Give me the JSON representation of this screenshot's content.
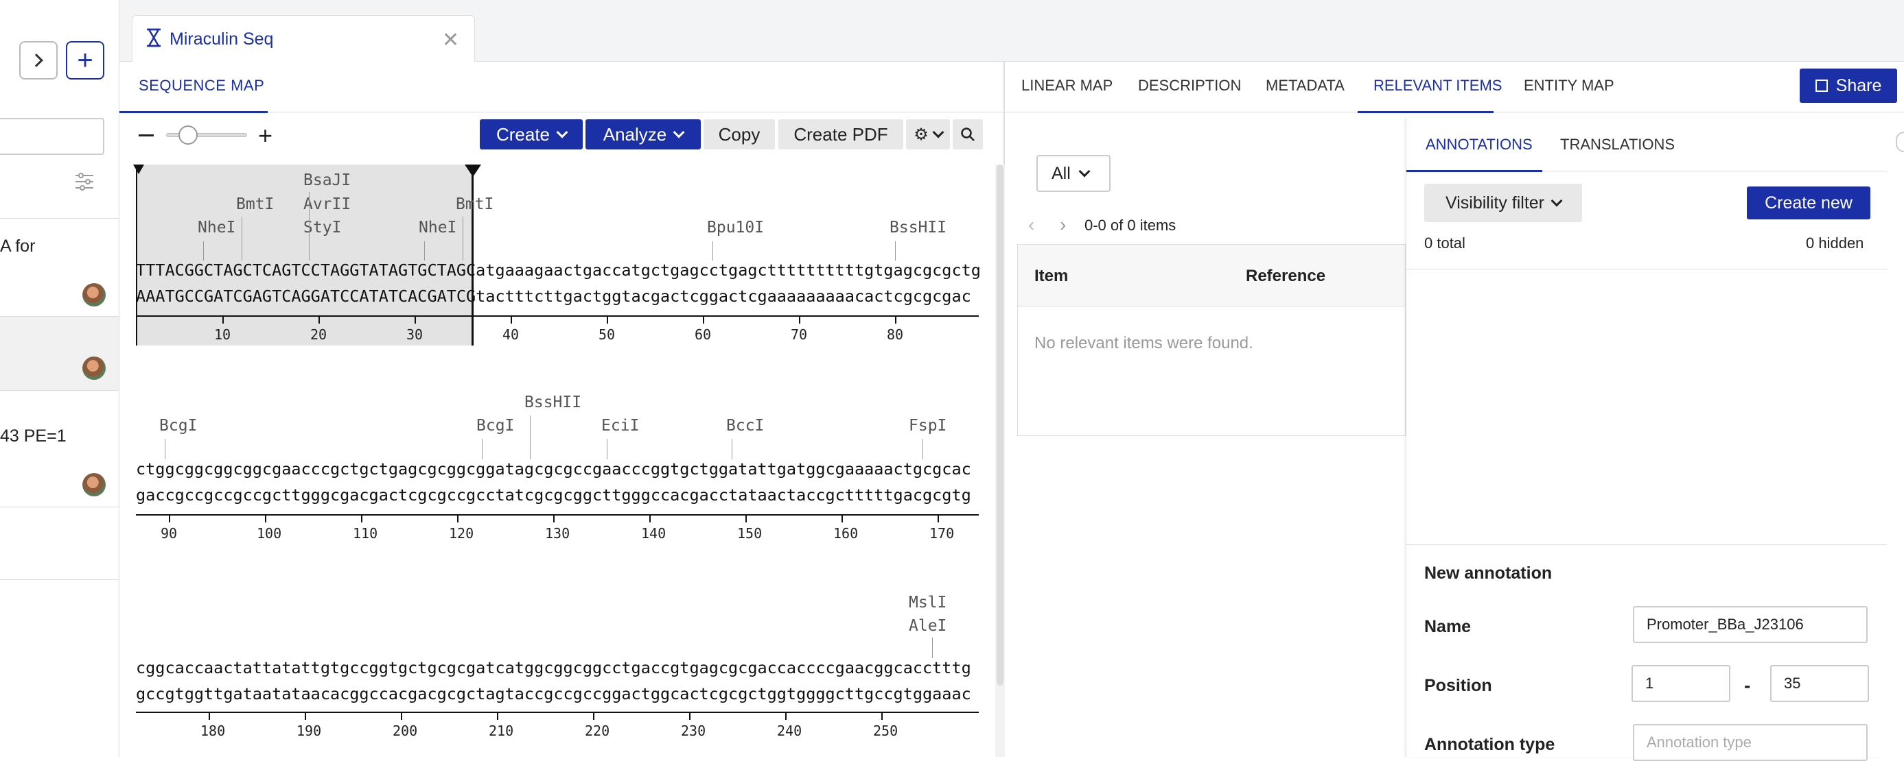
{
  "sidebar": {
    "items": [
      {
        "text": "A for"
      },
      {
        "text": ""
      },
      {
        "text": "43 PE=1"
      }
    ]
  },
  "doc_tab": {
    "title": "Miraculin Seq"
  },
  "seq_panel": {
    "tab": "SEQUENCE MAP",
    "toolbar": {
      "create": "Create",
      "analyze": "Analyze",
      "copy": "Copy",
      "create_pdf": "Create PDF"
    },
    "rows": [
      {
        "top": "TTTACGGCTAGCTCAGTCCTAGGTATAGTGCTAGCatgaaagaactgaccatgctgagcctgagcttttttttttgtgagcgcgctg",
        "bottom": "AAATGCCGATCGAGTCAGGATCCATATCACGATCGtactttcttgactggtacgactcggactcgaaaaaaaaacactcgcgcgac",
        "ticks": [
          "10",
          "20",
          "30",
          "40",
          "50",
          "60",
          "70",
          "80"
        ],
        "enzymes": [
          "BsaJI",
          "BmtI",
          "AvrII",
          "BmtI",
          "NheI",
          "StyI",
          "NheI",
          "Bpu10I",
          "BssHII"
        ]
      },
      {
        "top": "ctggcggcggcggcgaacccgctgctgagcgcggcggatagcgcgccgaacccggtgctggatattgatggcgaaaaactgcgcac",
        "bottom": "gaccgccgccgccgcttgggcgacgactcgcgccgcctatcgcgcggcttgggccacgacctataactaccgctttttgacgcgtg",
        "ticks": [
          "90",
          "100",
          "110",
          "120",
          "130",
          "140",
          "150",
          "160",
          "170"
        ],
        "enzymes": [
          "BssHII",
          "BcgI",
          "BcgI",
          "EciI",
          "BccI",
          "FspI"
        ]
      },
      {
        "top": "cggcaccaactattatattgtgccggtgctgcgcgatcatggcggcggcctgaccgtgagcgcgaccaccccgaacggcacctttg",
        "bottom": "gccgtggttgataatataacacggccacgacgcgctagtaccgccgccggactggcactcgcgctggtggggcttgccgtggaaac",
        "ticks": [
          "180",
          "190",
          "200",
          "210",
          "220",
          "230",
          "240",
          "250"
        ],
        "enzymes": [
          "MslI",
          "AleI"
        ]
      }
    ]
  },
  "right": {
    "tabs": [
      "LINEAR MAP",
      "DESCRIPTION",
      "METADATA",
      "RELEVANT ITEMS",
      "ENTITY MAP"
    ],
    "share": "Share",
    "filter_value": "All",
    "pager": "0-0 of 0 items",
    "table": {
      "col_item": "Item",
      "col_reference": "Reference",
      "empty": "No relevant items were found."
    }
  },
  "annotations": {
    "tabs": [
      "ANNOTATIONS",
      "TRANSLATIONS"
    ],
    "visibility_filter": "Visibility filter",
    "create_new": "Create new",
    "total": "0 total",
    "hidden": "0 hidden",
    "new_title": "New annotation",
    "name_label": "Name",
    "name_value": "Promoter_BBa_J23106",
    "position_label": "Position",
    "position_start": "1",
    "position_dash": "-",
    "position_end": "35",
    "type_label": "Annotation type",
    "type_placeholder": "Annotation type"
  },
  "colors": {
    "accent": "#1b2fa6",
    "selection": "#e3e3e3"
  }
}
